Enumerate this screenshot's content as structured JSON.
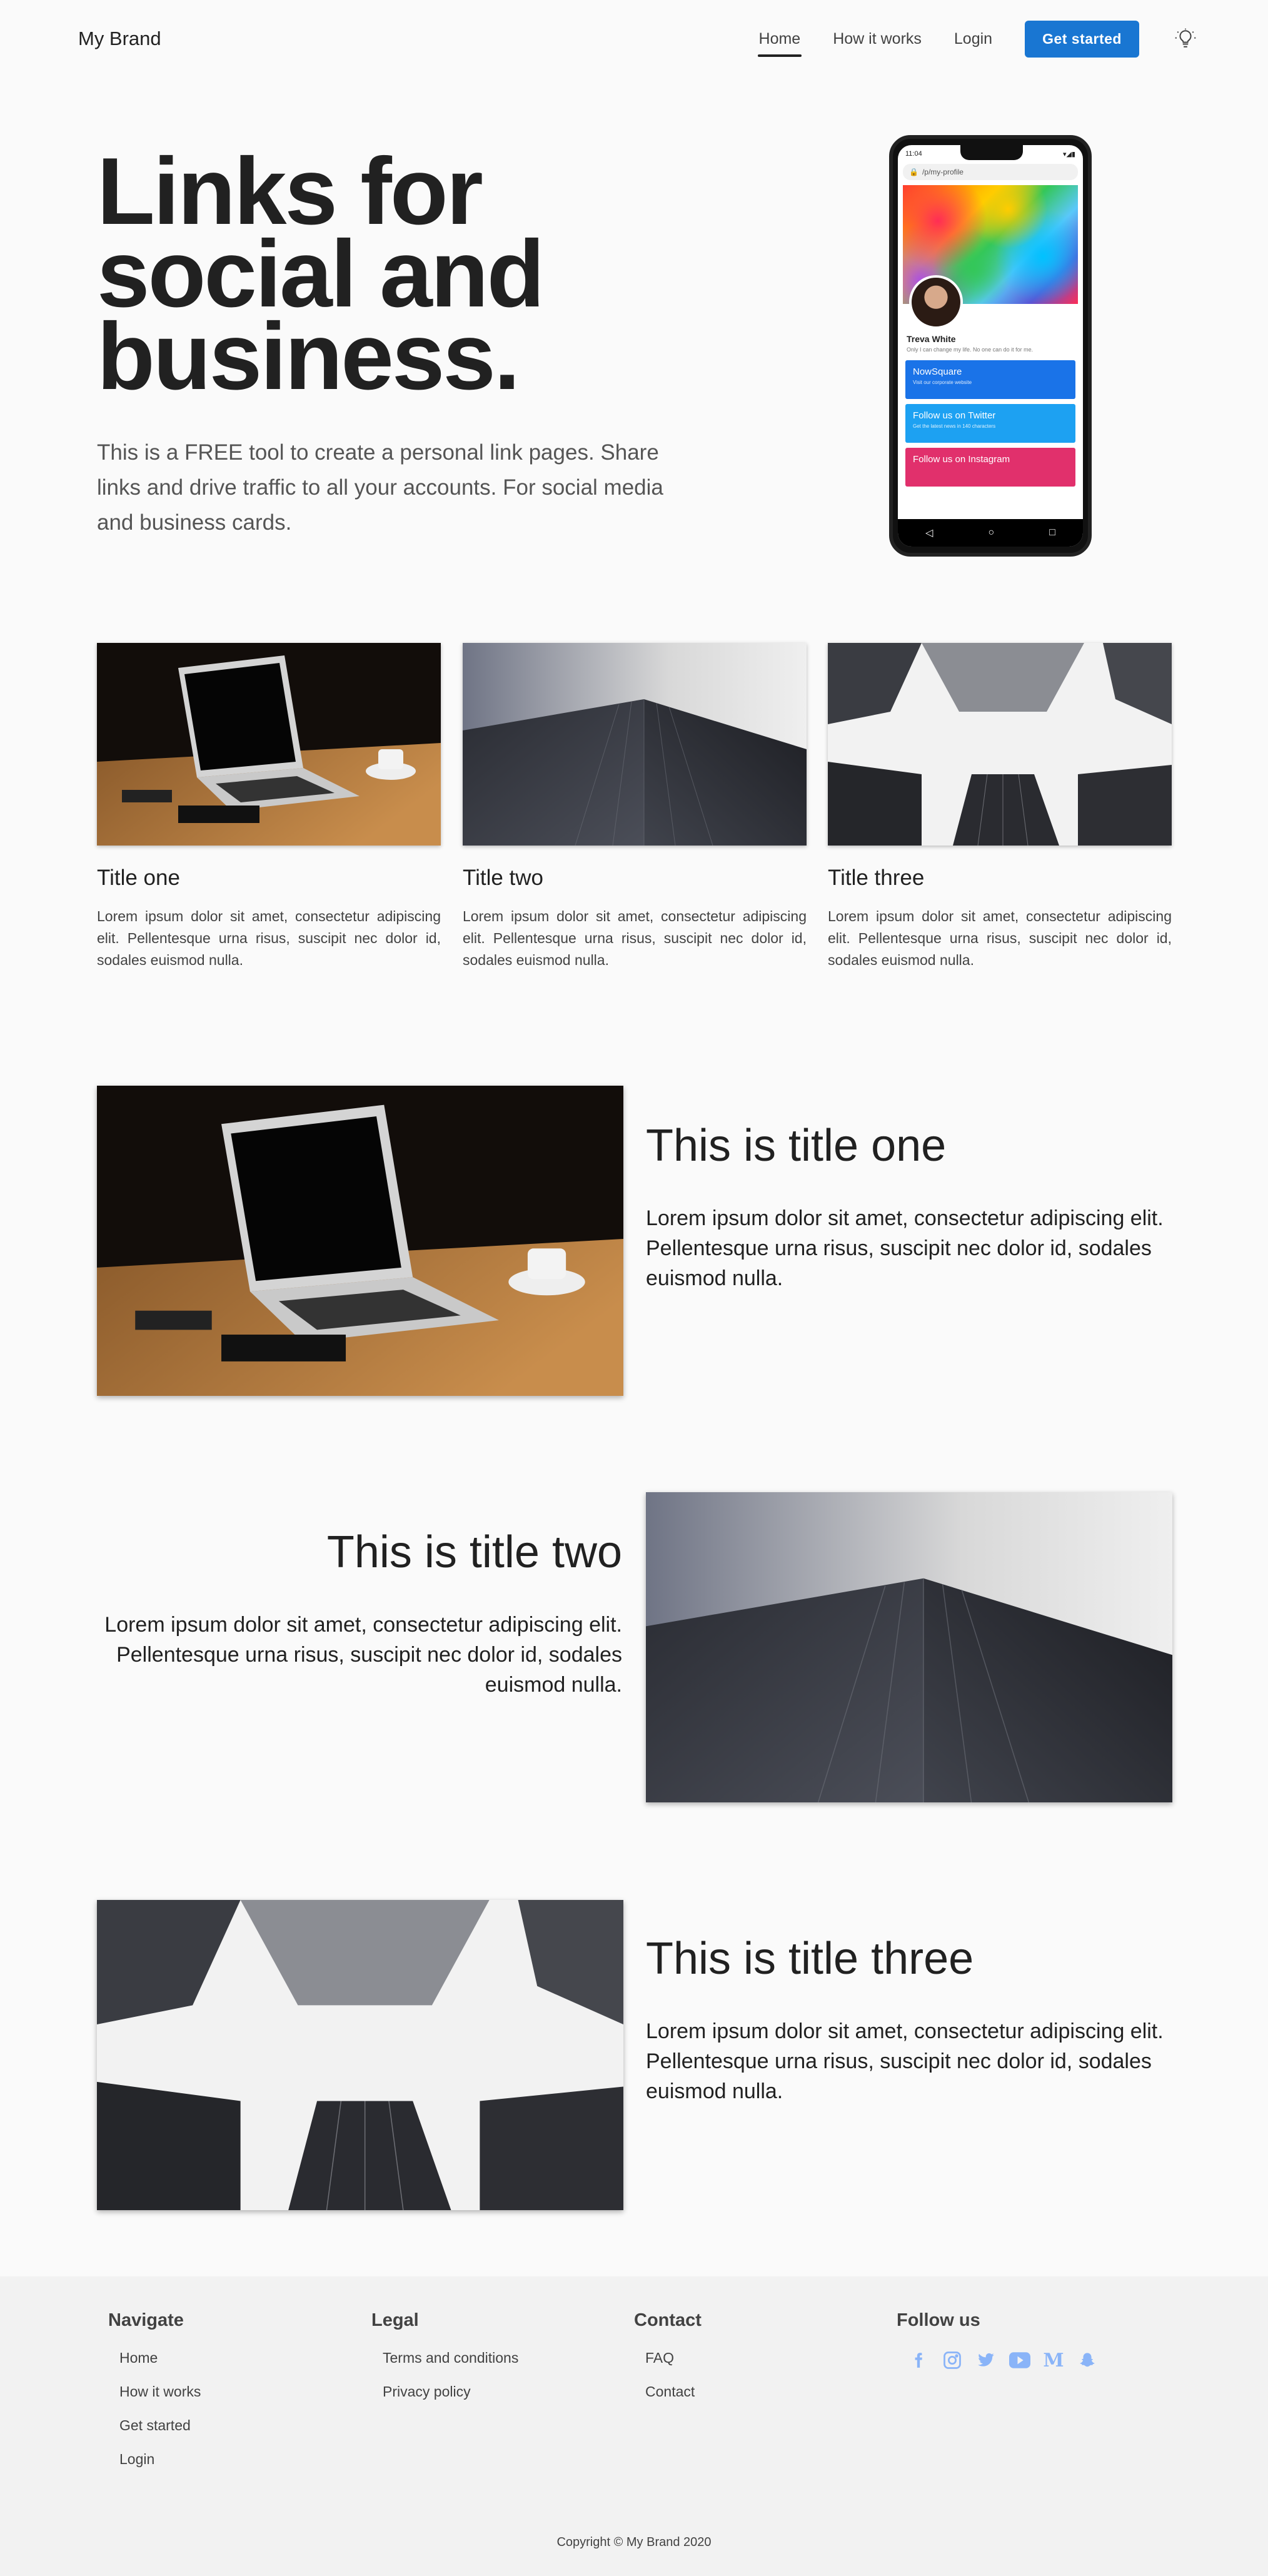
{
  "nav": {
    "brand": "My Brand",
    "links": [
      "Home",
      "How it works",
      "Login"
    ],
    "cta": "Get started"
  },
  "hero": {
    "title_line1": "Links for",
    "title_line2": "social and",
    "title_line3": "business.",
    "description": "This is a FREE tool to create a personal link pages. Share links and drive traffic to all your accounts. For social media and business cards."
  },
  "phone": {
    "time": "11:04",
    "url": "/p/my-profile",
    "name": "Treva White",
    "bio": "Only I can change my life. No one can do it for me.",
    "links": [
      {
        "title": "NowSquare",
        "sub": "Visit our corporate website",
        "color": "#1a73e8"
      },
      {
        "title": "Follow us on Twitter",
        "sub": "Get the latest news in 140 characters",
        "color": "#1da1f2"
      },
      {
        "title": "Follow us on Instagram",
        "sub": "",
        "color": "#e1306c"
      }
    ]
  },
  "cards": [
    {
      "title": "Title one",
      "text": "Lorem ipsum dolor sit amet, consectetur adipiscing elit. Pellentesque urna risus, suscipit nec dolor id, sodales euismod nulla."
    },
    {
      "title": "Title two",
      "text": "Lorem ipsum dolor sit amet, consectetur adipiscing elit. Pellentesque urna risus, suscipit nec dolor id, sodales euismod nulla."
    },
    {
      "title": "Title three",
      "text": "Lorem ipsum dolor sit amet, consectetur adipiscing elit. Pellentesque urna risus, suscipit nec dolor id, sodales euismod nulla."
    }
  ],
  "features": [
    {
      "title": "This is title one",
      "text": "Lorem ipsum dolor sit amet, consectetur adipiscing elit. Pellentesque urna risus, suscipit nec dolor id, sodales euismod nulla."
    },
    {
      "title": "This is title two",
      "text": "Lorem ipsum dolor sit amet, consectetur adipiscing elit. Pellentesque urna risus, suscipit nec dolor id, sodales euismod nulla."
    },
    {
      "title": "This is title three",
      "text": "Lorem ipsum dolor sit amet, consectetur adipiscing elit. Pellentesque urna risus, suscipit nec dolor id, sodales euismod nulla."
    }
  ],
  "footer": {
    "navigate": {
      "heading": "Navigate",
      "items": [
        "Home",
        "How it works",
        "Get started",
        "Login"
      ]
    },
    "legal": {
      "heading": "Legal",
      "items": [
        "Terms and conditions",
        "Privacy policy"
      ]
    },
    "contact": {
      "heading": "Contact",
      "items": [
        "FAQ",
        "Contact"
      ]
    },
    "follow": {
      "heading": "Follow us",
      "icons": [
        "facebook-icon",
        "instagram-icon",
        "twitter-icon",
        "youtube-icon",
        "medium-icon",
        "snapchat-icon"
      ],
      "icon_color": "#8ab4f8"
    },
    "copyright": "Copyright © My Brand 2020"
  },
  "colors": {
    "primary": "#1976d2",
    "text": "#212121",
    "background": "#fafafa"
  }
}
